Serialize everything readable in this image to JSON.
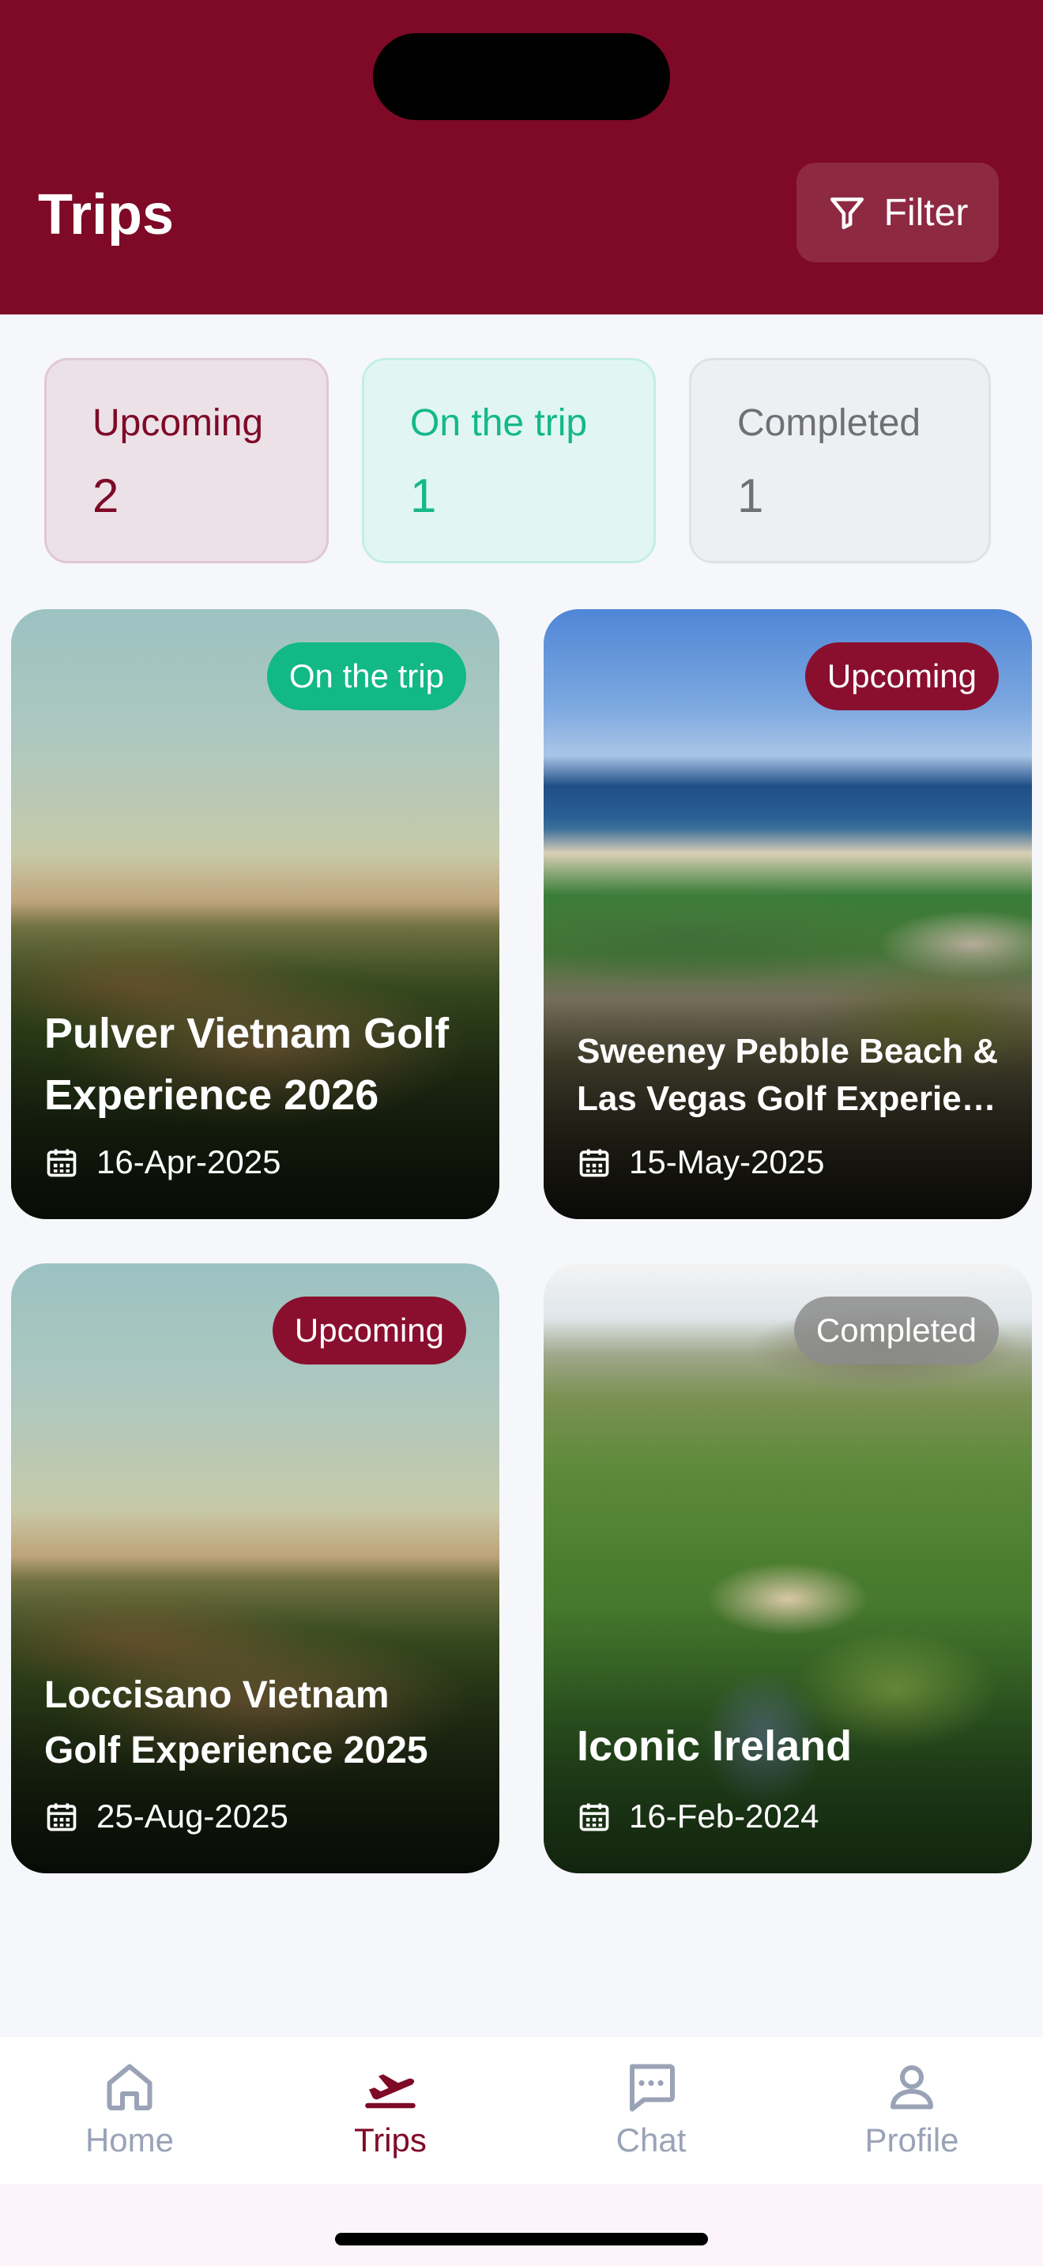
{
  "header": {
    "title": "Trips",
    "filter_label": "Filter",
    "background": "#7e0a27"
  },
  "stats": [
    {
      "label": "Upcoming",
      "count": "2",
      "color": "#7e0a27"
    },
    {
      "label": "On the trip",
      "count": "1",
      "color": "#14b88a"
    },
    {
      "label": "Completed",
      "count": "1",
      "color": "#6f7075"
    }
  ],
  "trips": [
    {
      "status": "On the trip",
      "title_line1": "Pulver Vietnam Golf",
      "title_line2": "Experience 2026",
      "date": "16-Apr-2025",
      "image": "golf-dunes-sunset"
    },
    {
      "status": "Upcoming",
      "title_line1": "Sweeney Pebble Beach &",
      "title_line2": "Las Vegas Golf Experien...",
      "date": "15-May-2025",
      "image": "coastal-golf-course"
    },
    {
      "status": "Upcoming",
      "title_line1": "Loccisano Vietnam",
      "title_line2": "Golf Experience 2025",
      "date": "25-Aug-2025",
      "image": "golf-dunes-sunset"
    },
    {
      "status": "Completed",
      "title_line1": "Iconic Ireland",
      "title_line2": "",
      "date": "16-Feb-2024",
      "image": "resort-aerial"
    }
  ],
  "nav": {
    "items": [
      {
        "label": "Home",
        "icon": "home-icon"
      },
      {
        "label": "Trips",
        "icon": "plane-departure-icon"
      },
      {
        "label": "Chat",
        "icon": "chat-icon"
      },
      {
        "label": "Profile",
        "icon": "person-icon"
      }
    ],
    "active": "Trips",
    "active_color": "#7e0a27",
    "inactive_color": "#9aa3b6"
  }
}
